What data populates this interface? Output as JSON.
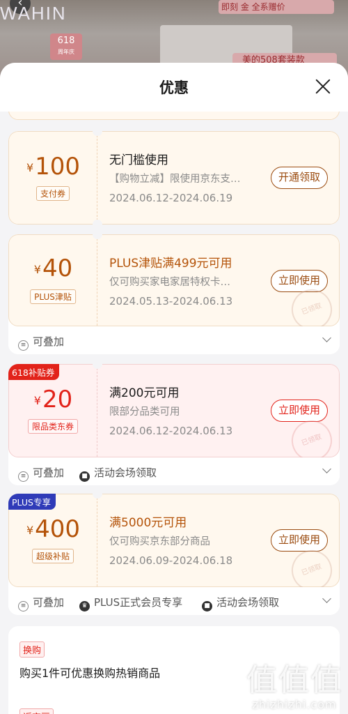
{
  "background": {
    "logo": "WAHIN",
    "back_icon": "back-arrow-icon",
    "badge_618_top": "618",
    "badge_618_sub": "周年庆",
    "promo_pill_top": "即刻   金   全系赠价",
    "promo_pill": "美的508套装款"
  },
  "sheet": {
    "title": "优惠",
    "close_icon": "close-icon"
  },
  "coupons": [
    {
      "currency": "¥",
      "amount": "100",
      "tag": "支付券",
      "title": "无门槛使用",
      "desc": "【购物立减】限使用京东支付…",
      "dates": "2024.06.12-2024.06.19",
      "button": "开通领取",
      "color": "#b45309"
    },
    {
      "currency": "¥",
      "amount": "40",
      "tag": "PLUS津贴",
      "title": "PLUS津贴满499元可用",
      "desc": "仅可购买家电家居特权卡…",
      "dates": "2024.05.13-2024.06.13",
      "button": "立即使用",
      "stamp": "已领取",
      "footer": [
        {
          "icon": "stack-icon",
          "label": "可叠加"
        }
      ]
    },
    {
      "corner_tag": "618补贴券",
      "currency": "¥",
      "amount": "20",
      "tag": "限品类东券",
      "title": "满200元可用",
      "desc": "限部分品类可用",
      "dates": "2024.06.12-2024.06.13",
      "button": "立即使用",
      "stamp": "已领取",
      "footer": [
        {
          "icon": "stack-icon",
          "label": "可叠加"
        },
        {
          "icon": "venue-icon",
          "label": "活动会场领取"
        }
      ]
    },
    {
      "corner_tag": "PLUS专享",
      "currency": "¥",
      "amount": "400",
      "tag": "超级补贴",
      "title": "满5000元可用",
      "desc": "仅可购买京东部分商品",
      "dates": "2024.06.09-2024.06.18",
      "button": "立即使用",
      "stamp": "已领取",
      "footer": [
        {
          "icon": "stack-icon",
          "label": "可叠加"
        },
        {
          "icon": "crown-icon",
          "label": "PLUS正式会员专享"
        },
        {
          "icon": "venue-icon",
          "label": "活动会场领取"
        }
      ]
    }
  ],
  "swap": {
    "tag": "换购",
    "text": "购买1件可优惠换购热销商品",
    "tag2": "返京豆"
  },
  "watermark": {
    "big": "值值值",
    "small": "zhizhizhi.com"
  },
  "colors": {
    "orange_text": "#b45309",
    "red": "#e2231a",
    "plus_blue": "#2f3bb8"
  }
}
